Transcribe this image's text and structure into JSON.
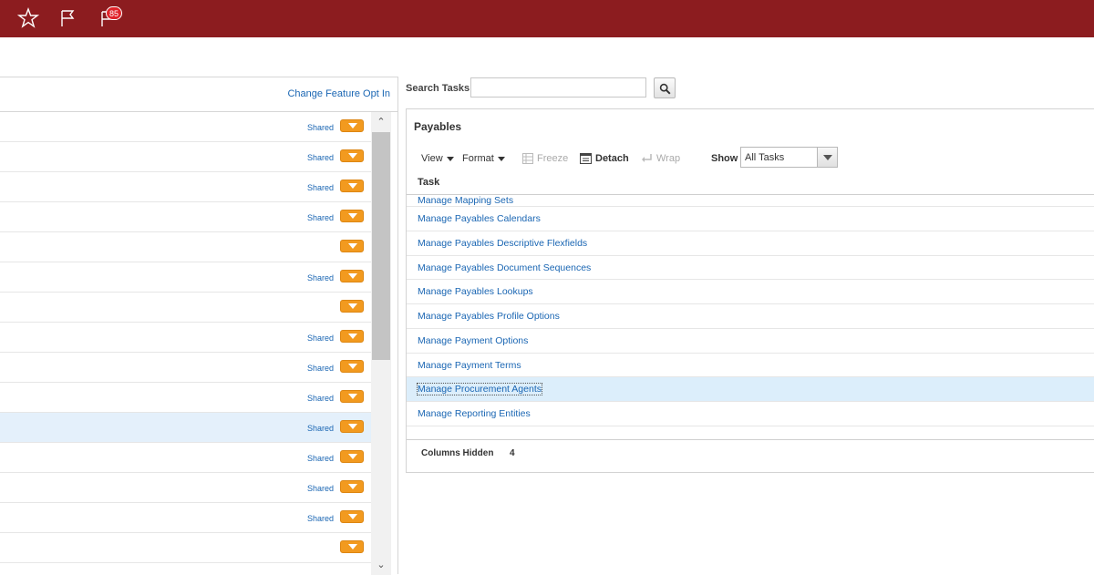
{
  "topbar": {
    "icons": [
      "star-icon",
      "flag-icon",
      "notifications-flag-icon"
    ],
    "notification_count": "85",
    "color": "#8c1c1f"
  },
  "left_panel": {
    "link": "Change Feature Opt In",
    "rows": [
      {
        "shared": "Shared"
      },
      {
        "shared": "Shared"
      },
      {
        "shared": "Shared"
      },
      {
        "shared": "Shared"
      },
      {
        "shared": ""
      },
      {
        "shared": "Shared"
      },
      {
        "shared": ""
      },
      {
        "shared": "Shared"
      },
      {
        "shared": "Shared"
      },
      {
        "shared": "Shared"
      },
      {
        "shared": "Shared",
        "selected": true
      },
      {
        "shared": "Shared"
      },
      {
        "shared": "Shared"
      },
      {
        "shared": "Shared"
      },
      {
        "shared": ""
      }
    ]
  },
  "search": {
    "label": "Search Tasks",
    "value": ""
  },
  "panel": {
    "title": "Payables",
    "toolbar": {
      "view": "View",
      "format": "Format",
      "freeze": "Freeze",
      "detach": "Detach",
      "wrap": "Wrap",
      "show": "Show",
      "show_value": "All Tasks"
    },
    "column_header": "Task",
    "tasks": [
      "Manage Mapping Sets",
      "Manage Payables Calendars",
      "Manage Payables Descriptive Flexfields",
      "Manage Payables Document Sequences",
      "Manage Payables Lookups",
      "Manage Payables Profile Options",
      "Manage Payment Options",
      "Manage Payment Terms",
      "Manage Procurement Agents",
      "Manage Reporting Entities"
    ],
    "selected_task": "Manage Procurement Agents",
    "columns_hidden_label": "Columns Hidden",
    "columns_hidden_value": "4"
  }
}
